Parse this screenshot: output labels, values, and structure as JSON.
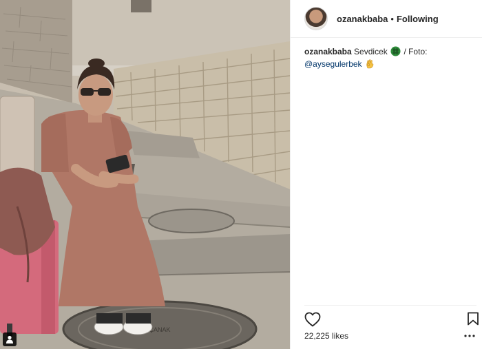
{
  "header": {
    "username": "ozanakbaba",
    "separator": "•",
    "follow_status": "Following"
  },
  "caption": {
    "username": "ozanakbaba",
    "text_before_emoji": "Sevdicek",
    "text_after_emoji": "/ Foto:",
    "mention": "@aysegulerbek"
  },
  "actions": {
    "like_icon": "heart-icon",
    "save_icon": "bookmark-icon",
    "more_icon": "more-options-icon"
  },
  "likes": {
    "count": "22,225",
    "label": "likes"
  },
  "photo": {
    "description_icon": "user-tag-icon",
    "manhole_text": "ÇANAK"
  },
  "colors": {
    "text": "#262626",
    "mention": "#003569",
    "border": "#efefef",
    "clover": "#2e8b3a"
  }
}
